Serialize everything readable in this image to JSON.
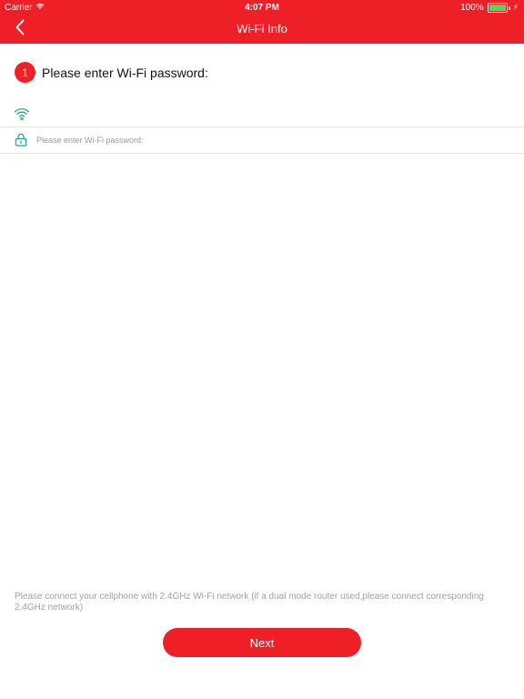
{
  "status_bar": {
    "carrier": "Carrier",
    "time": "4:07 PM",
    "battery": "100%"
  },
  "nav": {
    "title": "Wi-Fi Info",
    "back_icon": "chevron-left-icon"
  },
  "step": {
    "number": "1",
    "label": "Please enter Wi-Fi password:"
  },
  "wifi": {
    "network_name": "",
    "icon": "wifi-icon",
    "icon_color": "#1aa88a"
  },
  "password": {
    "value": "",
    "placeholder": "Please enter Wi-Fi password:",
    "icon": "lock-icon",
    "icon_color": "#1aa88a"
  },
  "hint": "Please connect your cellphone with 2.4GHz Wi-Fi network (if a dual mode router used,please connect corresponding 2.4GHz network)",
  "next_label": "Next",
  "colors": {
    "accent": "#ee1f26",
    "wifi_green": "#1aa88a",
    "battery_green": "#4cd964"
  }
}
